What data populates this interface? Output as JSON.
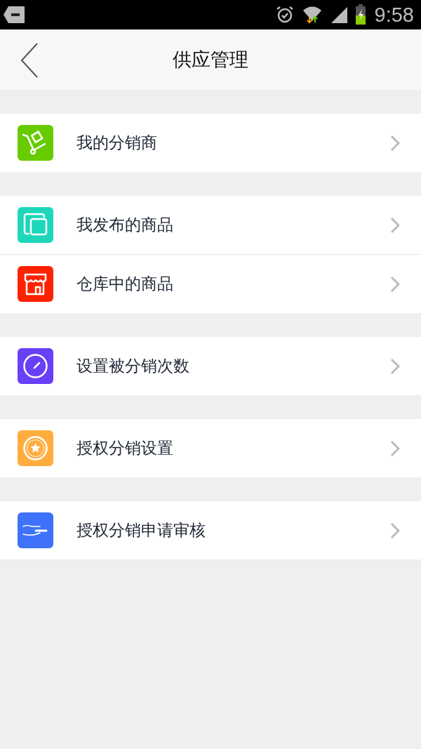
{
  "status_bar": {
    "time": "9:58"
  },
  "header": {
    "title": "供应管理"
  },
  "groups": [
    {
      "items": [
        {
          "label": "我的分销商",
          "kind": "cart",
          "color": "#66cc00"
        }
      ]
    },
    {
      "items": [
        {
          "label": "我发布的商品",
          "kind": "pages",
          "color": "#1ed7bb"
        },
        {
          "label": "仓库中的商品",
          "kind": "store",
          "color": "#ff2200"
        }
      ]
    },
    {
      "items": [
        {
          "label": "设置被分销次数",
          "kind": "gauge",
          "color": "#6a3ff8"
        }
      ]
    },
    {
      "items": [
        {
          "label": "授权分销设置",
          "kind": "medal",
          "color": "#ffad3d"
        }
      ]
    },
    {
      "items": [
        {
          "label": "授权分销申请审核",
          "kind": "hand",
          "color": "#3e72fb"
        }
      ]
    }
  ]
}
